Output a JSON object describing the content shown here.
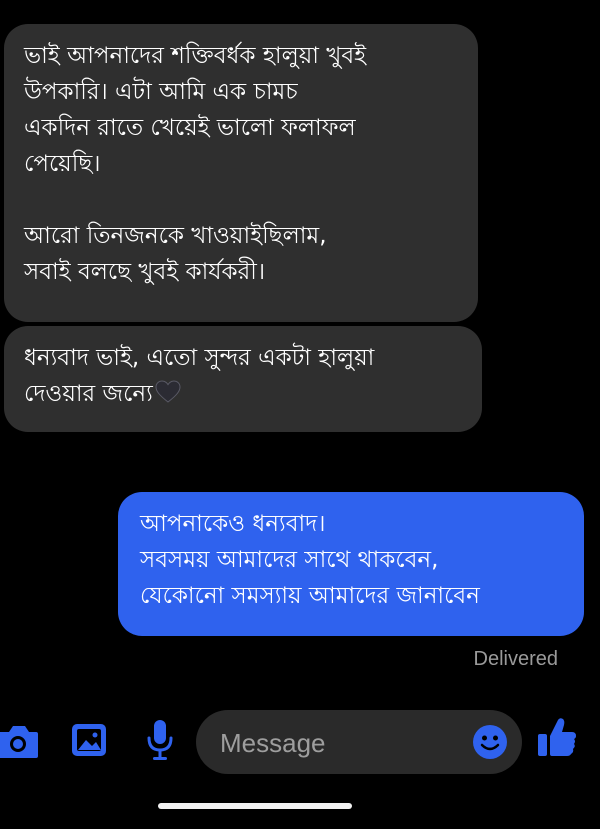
{
  "messages": [
    {
      "direction": "incoming",
      "lines": [
        "ভাই আপনাদের শক্তিবর্ধক হালুয়া খুবই",
        "উপকারি।  এটা আমি এক চামচ",
        "একদিন রাতে খেয়েই ভালো ফলাফল",
        "পেয়েছি।",
        "",
        "আরো তিনজনকে খাওয়াইছিলাম,",
        "সবাই বলছে খুবই কার্যকরী।"
      ]
    },
    {
      "direction": "incoming",
      "lines": [
        "ধন্যবাদ ভাই, এতো সুন্দর একটা হালুয়া",
        "দেওয়ার জন্যে"
      ],
      "trailing_emoji": "black-heart"
    },
    {
      "direction": "outgoing",
      "lines": [
        "আপনাকেও ধন্যবাদ।",
        "সবসময় আমাদের সাথে থাকবেন,",
        "যেকোনো সমস্যায় আমাদের জানাবেন"
      ]
    }
  ],
  "status": "Delivered",
  "composer": {
    "placeholder": "Message"
  },
  "toolbar": {
    "icons": [
      "camera-icon",
      "gallery-icon",
      "mic-icon",
      "emoji-icon",
      "thumbs-up-icon"
    ],
    "accent_color": "#2f62ee"
  },
  "colors": {
    "background": "#000000",
    "incoming_bubble": "#2f2f2f",
    "outgoing_bubble": "#2f62ee",
    "status_text": "#9a9a9a"
  }
}
